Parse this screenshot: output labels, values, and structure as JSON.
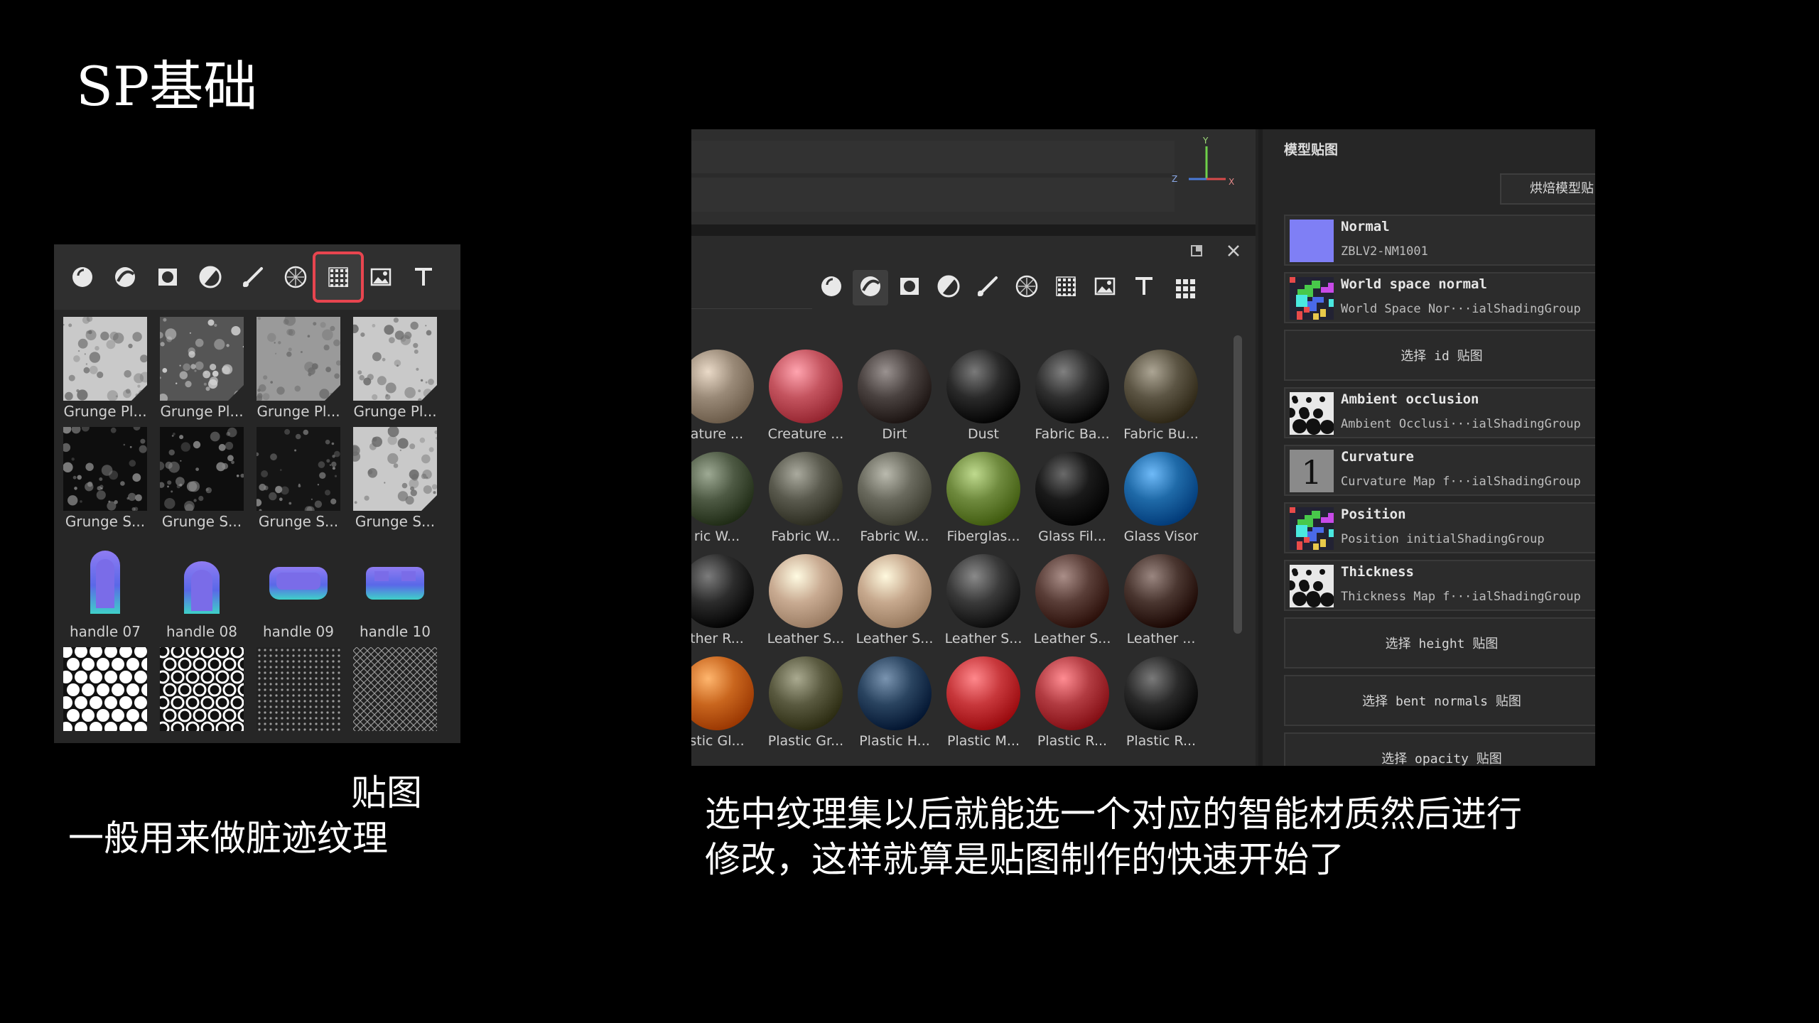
{
  "slide": {
    "title": "SP基础",
    "left_caption_line1": "贴图",
    "left_caption_line2": "一般用来做脏迹纹理",
    "right_caption_line1": "选中纹理集以后就能选一个对应的智能材质然后进行",
    "right_caption_line2": "修改，这样就算是贴图制作的快速开始了"
  },
  "left_shelf": {
    "tools": [
      {
        "icon": "sphere-icon"
      },
      {
        "icon": "smart-material-icon"
      },
      {
        "icon": "mask-icon"
      },
      {
        "icon": "filter-icon"
      },
      {
        "icon": "brush-icon"
      },
      {
        "icon": "particle-icon"
      },
      {
        "icon": "texture-icon",
        "selected": true
      },
      {
        "icon": "environment-icon"
      },
      {
        "icon": "text-icon"
      }
    ],
    "selected_outline_color": "#e8454f",
    "items": [
      {
        "label": "Grunge Pl...",
        "kind": "grunge-light"
      },
      {
        "label": "Grunge Pl...",
        "kind": "grunge-dark"
      },
      {
        "label": "Grunge Pl...",
        "kind": "grunge-mid"
      },
      {
        "label": "Grunge Pl...",
        "kind": "grunge-light"
      },
      {
        "label": "Grunge S...",
        "kind": "grunge-black"
      },
      {
        "label": "Grunge S...",
        "kind": "grunge-black"
      },
      {
        "label": "Grunge S...",
        "kind": "grunge-spots"
      },
      {
        "label": "Grunge S...",
        "kind": "grunge-light"
      },
      {
        "label": "handle 07",
        "kind": "handle-tall"
      },
      {
        "label": "handle 08",
        "kind": "handle-small"
      },
      {
        "label": "handle 09",
        "kind": "handle-flat"
      },
      {
        "label": "handle 10",
        "kind": "handle-box"
      },
      {
        "label": "",
        "kind": "hex-white"
      },
      {
        "label": "",
        "kind": "hex-ring"
      },
      {
        "label": "",
        "kind": "pattern-fine"
      },
      {
        "label": "",
        "kind": "pattern-diamond"
      }
    ]
  },
  "right_app": {
    "axis_labels": {
      "y": "Y",
      "z": "Z",
      "x": "X"
    },
    "panel_tools": [
      "sphere-icon",
      "smart-material-icon",
      "mask-icon",
      "filter-icon",
      "brush-icon",
      "particle-icon",
      "texture-icon",
      "environment-icon",
      "text-icon",
      "grid-view-icon"
    ],
    "materials": [
      {
        "label": "ature ...",
        "color": "#9a8a78"
      },
      {
        "label": "Creature ...",
        "color": "#c4545f"
      },
      {
        "label": "Dirt",
        "color": "#4a4240"
      },
      {
        "label": "Dust",
        "color": "#2a2a2a"
      },
      {
        "label": "Fabric Ba...",
        "color": "#303030"
      },
      {
        "label": "Fabric Bu...",
        "color": "#5c5544"
      },
      {
        "label": "ric W...",
        "color": "#4e5a44"
      },
      {
        "label": "Fabric W...",
        "color": "#5a5a4e"
      },
      {
        "label": "Fabric W...",
        "color": "#6a6a5e"
      },
      {
        "label": "Fiberglas...",
        "color": "#6f8a3e"
      },
      {
        "label": "Glass Fil...",
        "color": "#1a1a1a"
      },
      {
        "label": "Glass Visor",
        "color": "#1f6aa8"
      },
      {
        "label": "ther R...",
        "color": "#2c2c2c"
      },
      {
        "label": "Leather S...",
        "color": "#c9ab92"
      },
      {
        "label": "Leather S...",
        "color": "#c7a98e"
      },
      {
        "label": "Leather S...",
        "color": "#3a3a3a"
      },
      {
        "label": "Leather S...",
        "color": "#5a3e38"
      },
      {
        "label": "Leather ...",
        "color": "#4a3630"
      },
      {
        "label": "stic Gl...",
        "color": "#c9661e"
      },
      {
        "label": "Plastic Gr...",
        "color": "#5a5a40"
      },
      {
        "label": "Plastic H...",
        "color": "#2a4460"
      },
      {
        "label": "Plastic M...",
        "color": "#c8383c"
      },
      {
        "label": "Plastic R...",
        "color": "#b23c42"
      },
      {
        "label": "Plastic R...",
        "color": "#2a2a2a"
      }
    ],
    "maps_panel": {
      "header": "模型贴图",
      "bake_button": "烘焙模型贴",
      "rows": [
        {
          "type": "map",
          "title": "Normal",
          "sub": "ZBLV2-NM1001",
          "thumb": "normal-swatch",
          "color": "#7f7ff5"
        },
        {
          "type": "map",
          "title": "World space normal",
          "sub": "World Space Nor···ialShadingGroup",
          "thumb": "uv-thumb"
        },
        {
          "type": "button",
          "label": "选择 id 贴图"
        },
        {
          "type": "map",
          "title": "Ambient occlusion",
          "sub": "Ambient Occlusi···ialShadingGroup",
          "thumb": "ao-thumb"
        },
        {
          "type": "map",
          "title": "Curvature",
          "sub": "Curvature Map f···ialShadingGroup",
          "thumb": "curvature-thumb",
          "glyph": "1"
        },
        {
          "type": "map",
          "title": "Position",
          "sub": "Position initialShadingGroup",
          "thumb": "uv-thumb"
        },
        {
          "type": "map",
          "title": "Thickness",
          "sub": "Thickness Map f···ialShadingGroup",
          "thumb": "ao-thumb"
        },
        {
          "type": "button",
          "label": "选择 height 贴图"
        },
        {
          "type": "button",
          "label": "选择 bent normals 贴图"
        },
        {
          "type": "button",
          "label": "选择 opacity 贴图"
        }
      ]
    }
  }
}
